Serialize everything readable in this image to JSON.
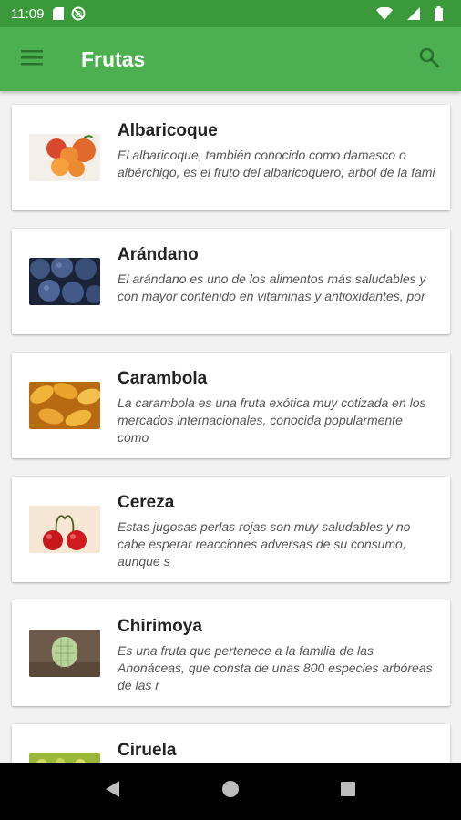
{
  "status_bar": {
    "time": "11:09",
    "icons": [
      "sd-card-icon",
      "do-not-disturb-icon",
      "wifi-icon",
      "signal-icon",
      "battery-icon"
    ]
  },
  "app_bar": {
    "title": "Frutas",
    "menu_icon": "hamburger-menu-icon",
    "search_icon": "search-icon",
    "color": "#4caf50"
  },
  "fruits": [
    {
      "name": "Albaricoque",
      "description": "El albaricoque, también conocido como damasco o albérchigo, es el fruto del albaricoquero, árbol de la fami",
      "image": "apricots-image"
    },
    {
      "name": "Arándano",
      "description": "El arándano es uno de los alimentos más saludables y con mayor contenido en vitaminas y antioxidantes, por",
      "image": "blueberries-image"
    },
    {
      "name": "Carambola",
      "description": "La carambola es una fruta exótica muy cotizada en los mercados internacionales, conocida popularmente como",
      "image": "starfruit-image"
    },
    {
      "name": "Cereza",
      "description": "Estas jugosas perlas rojas son muy saludables y no cabe esperar reacciones adversas de su consumo, aunque s",
      "image": "cherries-image"
    },
    {
      "name": "Chirimoya",
      "description": "Es una fruta que pertenece a la familia de las Anonáceas, que consta de unas 800 especies arbóreas de las r",
      "image": "cherimoya-image"
    },
    {
      "name": "Ciruela",
      "description": "",
      "image": "plums-image"
    }
  ],
  "nav_bar": {
    "icons": [
      "back-icon",
      "home-icon",
      "recents-icon"
    ]
  }
}
